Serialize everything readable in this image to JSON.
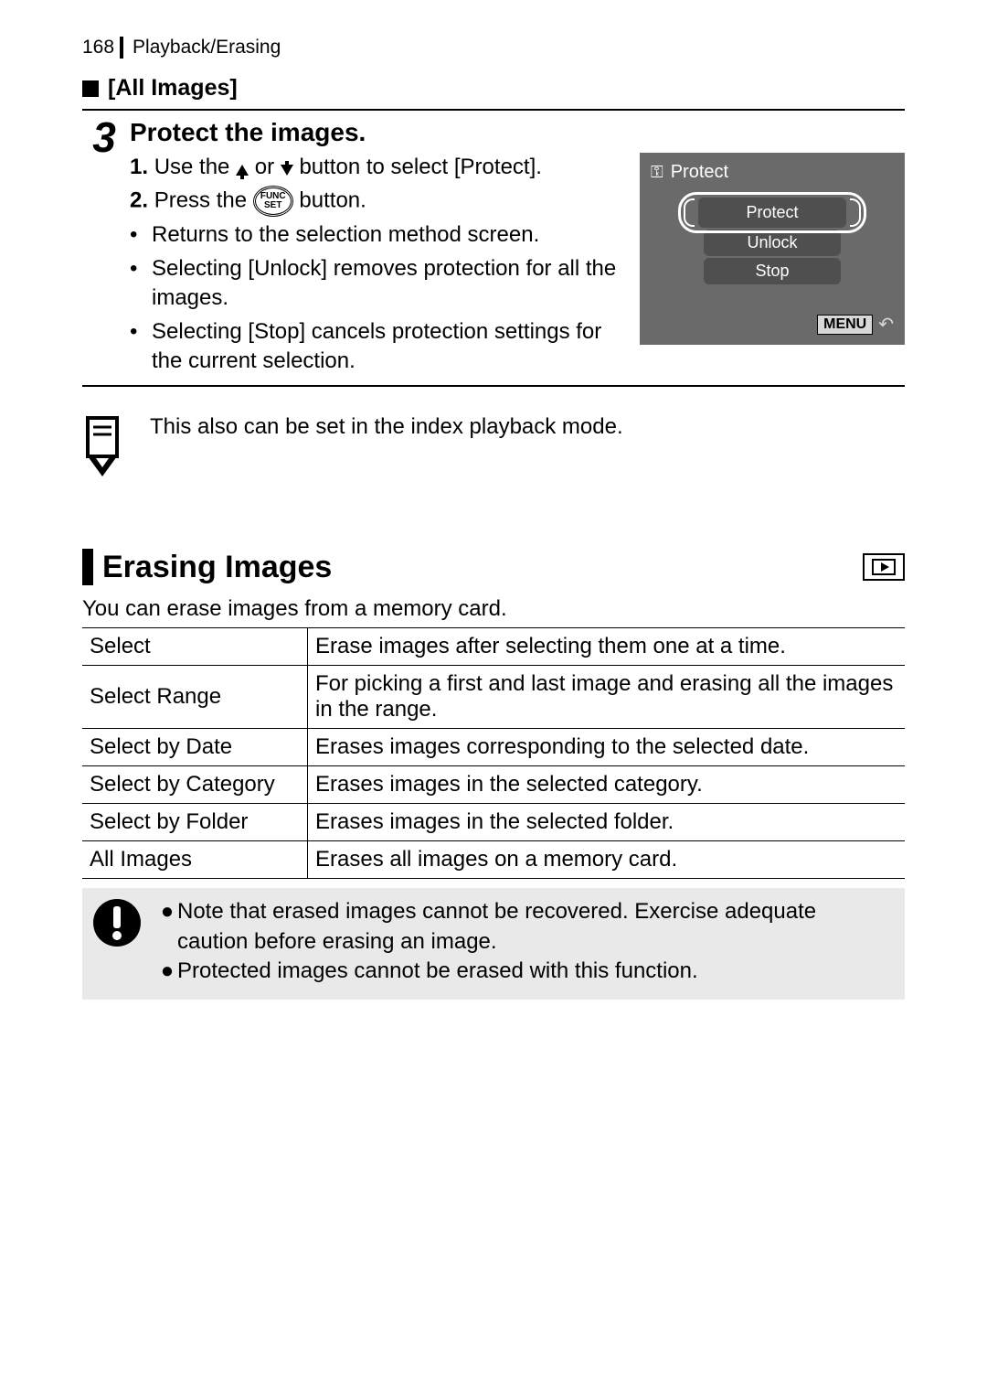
{
  "header": {
    "page_number": "168",
    "breadcrumb": "Playback/Erasing"
  },
  "section_all_images": {
    "heading": "[All Images]",
    "step_number": "3",
    "step_title": "Protect the images.",
    "line1_a": "Use the ",
    "line1_b": " or ",
    "line1_c": " button to select [Protect].",
    "line2_a": "Press the ",
    "line2_b": " button.",
    "func_top": "FUNC",
    "func_bottom": "SET",
    "bullets": [
      "Returns to the selection method screen.",
      "Selecting [Unlock] removes protection for all the images.",
      "Selecting [Stop] cancels protection settings for the current selection."
    ],
    "camera": {
      "title": "Protect",
      "opt_selected": "Protect",
      "opt_mid": "Unlock",
      "opt_bot": "Stop",
      "menu_label": "MENU"
    }
  },
  "note": "This also can be set in the index playback mode.",
  "erasing": {
    "title": "Erasing Images",
    "desc": "You can erase images from a memory card.",
    "table": [
      [
        "Select",
        "Erase images after selecting them one at a time."
      ],
      [
        "Select Range",
        "For picking a first and last image and erasing all the images in the range."
      ],
      [
        "Select by Date",
        "Erases images corresponding to the selected date."
      ],
      [
        "Select by Category",
        "Erases images in the selected category."
      ],
      [
        "Select by Folder",
        "Erases images in the selected folder."
      ],
      [
        "All Images",
        "Erases all images on a memory card."
      ]
    ],
    "cautions": [
      "Note that erased images cannot be recovered. Exercise adequate caution before erasing an image.",
      "Protected images cannot be erased with this function."
    ]
  }
}
